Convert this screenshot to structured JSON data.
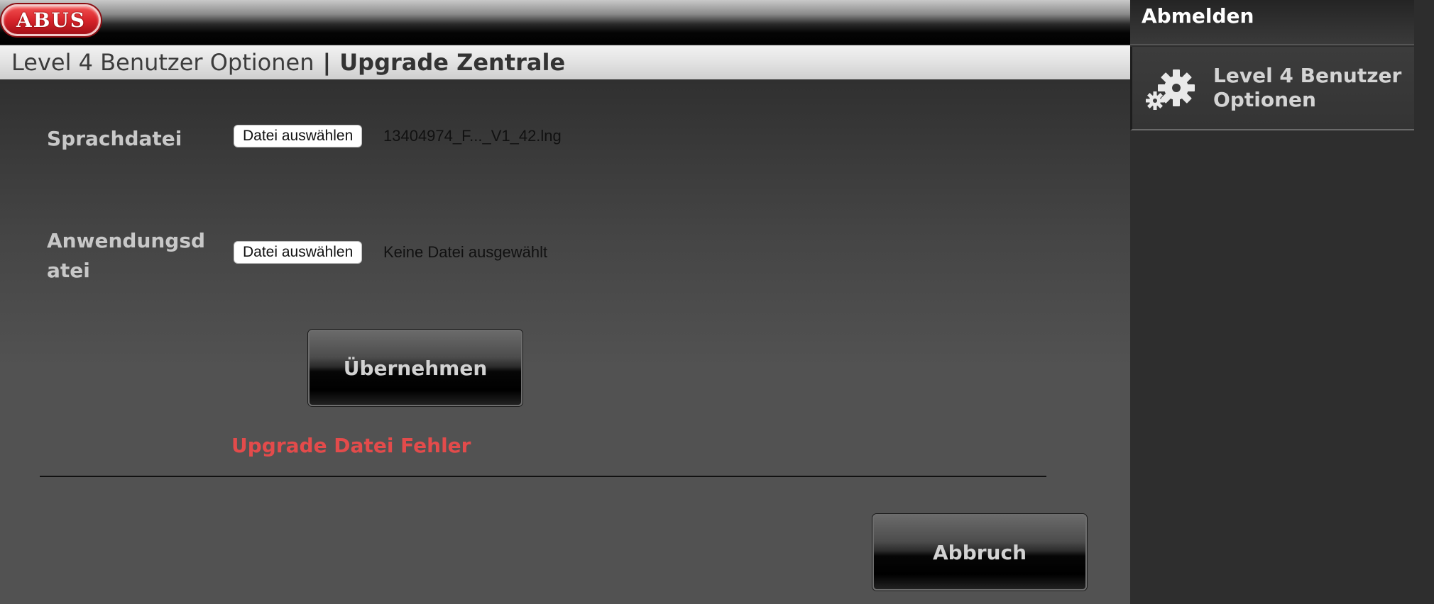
{
  "header": {
    "logo_text": "ABUS"
  },
  "breadcrumb": {
    "parent": "Level 4 Benutzer Optionen",
    "separator": "|",
    "current": "Upgrade Zentrale"
  },
  "form": {
    "language_file": {
      "label": "Sprachdatei",
      "button_label": "Datei auswählen",
      "file_name": "13404974_F..._V1_42.lng"
    },
    "application_file": {
      "label_line1": "Anwendungsd",
      "label_line2": "atei",
      "button_label": "Datei auswählen",
      "file_name": "Keine Datei ausgewählt"
    },
    "apply_button": "Übernehmen",
    "error_message": "Upgrade Datei Fehler",
    "cancel_button": "Abbruch"
  },
  "sidebar": {
    "logout_label": "Abmelden",
    "menu_item_label": "Level 4 Benutzer Optionen",
    "menu_item_icon": "gears-icon"
  },
  "colors": {
    "error": "#e34b4b",
    "logo_red": "#d7242b"
  }
}
